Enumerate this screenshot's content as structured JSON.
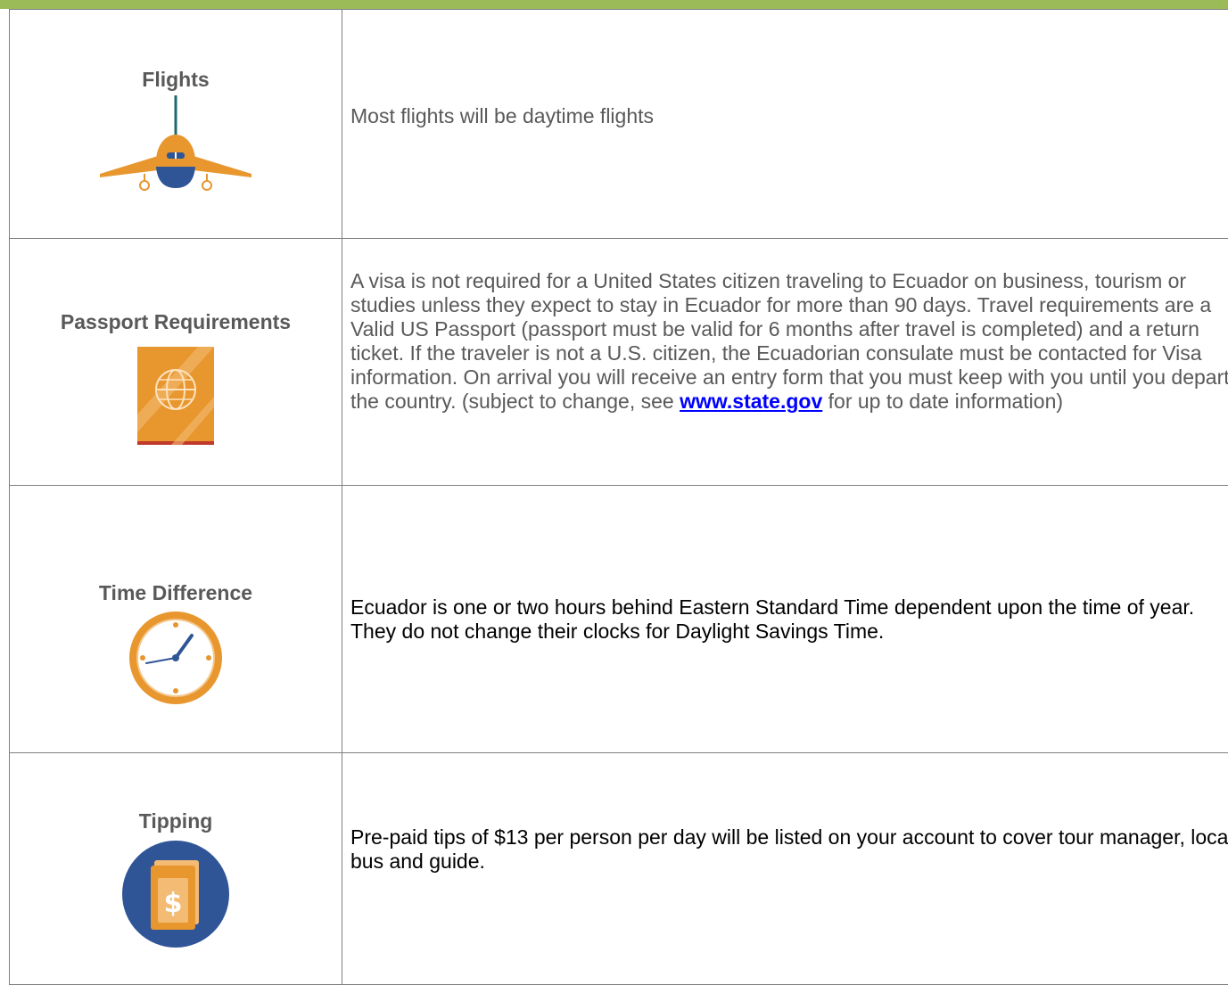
{
  "rows": [
    {
      "title": "Flights",
      "icon": "airplane-icon",
      "text": "Most flights will be daytime flights"
    },
    {
      "title": "Passport Requirements",
      "icon": "passport-icon",
      "text_before_link": "A visa is not required for a United States citizen traveling to Ecuador on business, tourism or studies unless they expect to stay in Ecuador for more than 90 days. Travel requirements are a Valid US Passport (passport must be valid for 6 months after travel is completed) and a return ticket.  If the traveler is not a U.S. citizen, the Ecuadorian consulate must be contacted for Visa information.  On arrival you will receive an entry form that you must keep with you until you depart the country. (subject to change, see ",
      "link_text": "www.state.gov",
      "text_after_link": " for up to date information)"
    },
    {
      "title": "Time Difference",
      "icon": "clock-icon",
      "text": "Ecuador is one or two hours behind Eastern Standard Time dependent upon the time of year.  They do not change their clocks for Daylight Savings Time."
    },
    {
      "title": "Tipping",
      "icon": "dollar-ticket-icon",
      "text": "Pre-paid tips of $13 per person per day will be listed on your account to cover tour manager, local bus and guide."
    }
  ],
  "colors": {
    "header_bar": "#9bbb59",
    "border": "#7f7f7f",
    "body_text": "#595959",
    "link": "#0000ff",
    "icon_orange": "#e8962e",
    "icon_blue": "#2f5597"
  }
}
